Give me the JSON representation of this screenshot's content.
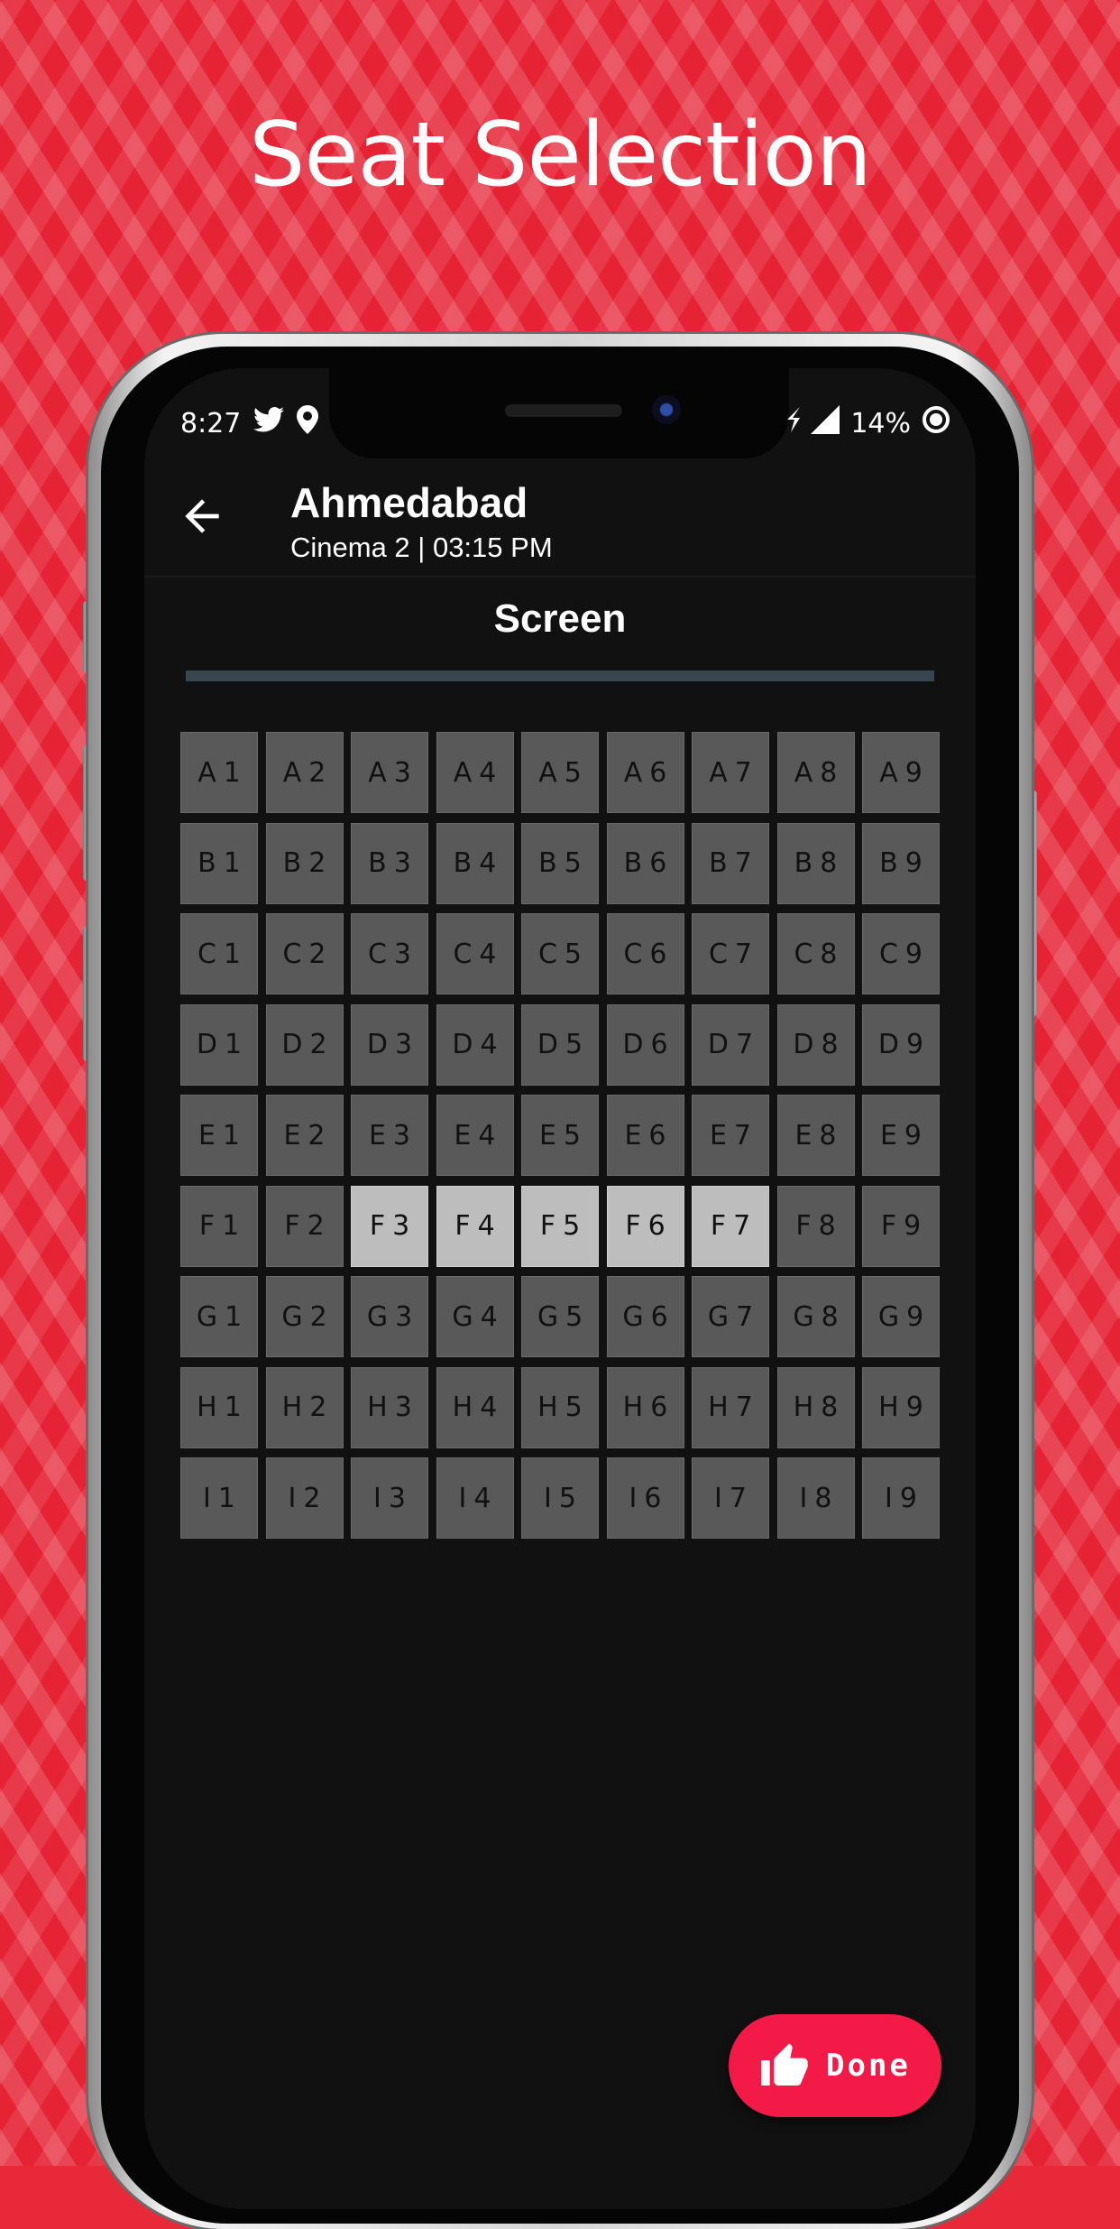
{
  "promo": {
    "headline": "Seat Selection"
  },
  "status_bar": {
    "time": "8:27",
    "left_icons": [
      "twitter-icon",
      "location-pin-icon"
    ],
    "right_icons": [
      "data-saver-icon",
      "cell-signal-icon",
      "battery-icon"
    ],
    "battery": "14%"
  },
  "app_bar": {
    "back_icon": "arrow-back-icon",
    "title": "Ahmedabad",
    "subtitle": "Cinema 2 | 03:15 PM"
  },
  "seat_map": {
    "screen_label": "Screen",
    "rows": [
      "A",
      "B",
      "C",
      "D",
      "E",
      "F",
      "G",
      "H",
      "I"
    ],
    "columns": [
      1,
      2,
      3,
      4,
      5,
      6,
      7,
      8,
      9
    ],
    "selected": [
      "F3",
      "F4",
      "F5",
      "F6",
      "F7"
    ]
  },
  "fab": {
    "icon": "thumb-up-icon",
    "label": "Done"
  },
  "colors": {
    "background_red": "#e52335",
    "app_bg": "#111111",
    "seat_available": "#595959",
    "seat_selected": "#bdbdbd",
    "screen_line": "#37474f",
    "fab": "#f31a47"
  }
}
